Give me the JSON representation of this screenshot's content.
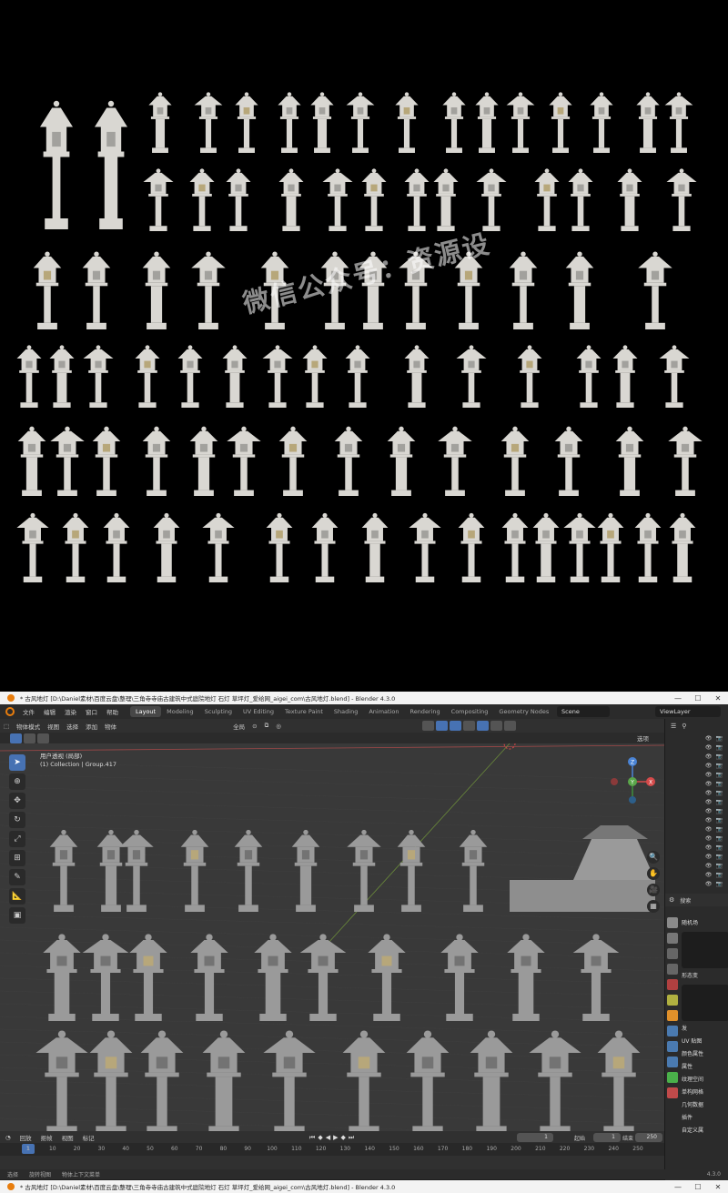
{
  "gallery": {
    "watermark": "微信公众号：资源设"
  },
  "window": {
    "title": "* 古风地灯 [D:\\Daniel素材\\百度云盘\\整理\\三角寺寺庙古建筑中式庭院地灯 石灯 草坪灯_爱给网_aigei_com\\古风地灯.blend] - Blender 4.3.0",
    "minimize": "—",
    "maximize": "☐",
    "close": "✕"
  },
  "menubar": {
    "items": [
      "文件",
      "编辑",
      "渲染",
      "窗口",
      "帮助"
    ],
    "workspaces": [
      "Layout",
      "Modeling",
      "Sculpting",
      "UV Editing",
      "Texture Paint",
      "Shading",
      "Animation",
      "Rendering",
      "Compositing",
      "Geometry Nodes",
      "Sc"
    ],
    "active_workspace": "Layout",
    "scene": "Scene",
    "view_layer": "ViewLayer"
  },
  "header": {
    "mode": "物体模式",
    "menus": [
      "视图",
      "选择",
      "添加",
      "物体"
    ],
    "transform": "全局",
    "options": "选项"
  },
  "viewport": {
    "view_name": "用户透视 (局部)",
    "collection": "(1) Collection | Group.417",
    "axis_x": "X",
    "axis_y": "Y",
    "axis_z": "Z"
  },
  "properties": {
    "search": "搜索",
    "rows": [
      "随机场",
      "形态变",
      "UV 贴图",
      "颜色属性",
      "属性",
      "纹理空间",
      "单构网格",
      "几何数据",
      "插件",
      "自定义属"
    ],
    "wave_label": "发"
  },
  "timeline": {
    "menus": [
      "回放",
      "抠帧",
      "视图",
      "标记"
    ],
    "current_frame": "1",
    "start_label": "起始",
    "start": "1",
    "end_label": "结束",
    "end": "250",
    "ruler": [
      "1",
      "10",
      "20",
      "30",
      "40",
      "50",
      "60",
      "70",
      "80",
      "90",
      "100",
      "110",
      "120",
      "130",
      "140",
      "150",
      "160",
      "170",
      "180",
      "190",
      "200",
      "210",
      "220",
      "230",
      "240",
      "250"
    ]
  },
  "statusbar": {
    "left": "选择",
    "middle": "旋转视图",
    "right": "物体上下文菜单",
    "version": "4.3.0"
  },
  "colors": {
    "accent": "#4772b3",
    "blender_orange": "#e87d0d",
    "lantern": "#d9d7d2"
  }
}
